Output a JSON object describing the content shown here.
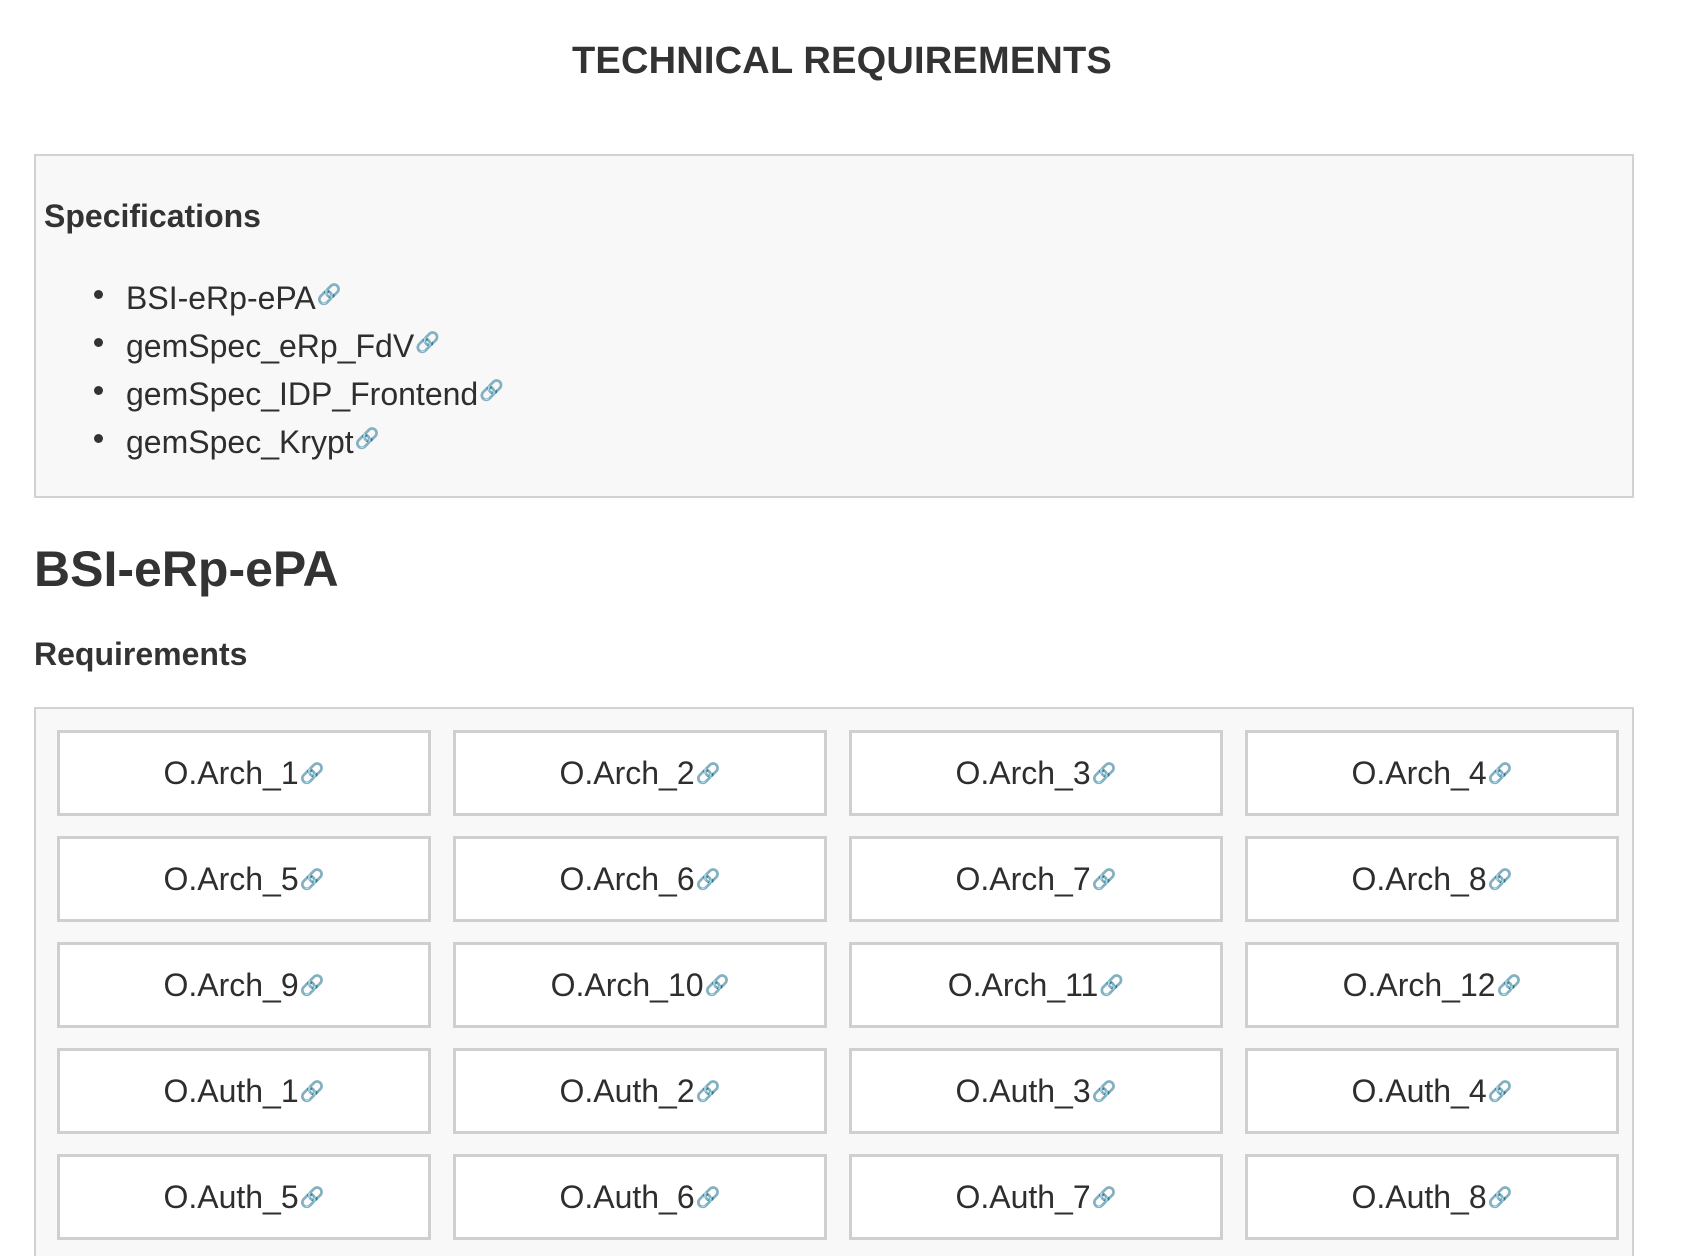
{
  "page": {
    "title": "TECHNICAL REQUIREMENTS"
  },
  "specifications": {
    "heading": "Specifications",
    "link_icon": "🔗",
    "items": [
      {
        "label": "BSI-eRp-ePA"
      },
      {
        "label": "gemSpec_eRp_FdV"
      },
      {
        "label": "gemSpec_IDP_Frontend"
      },
      {
        "label": "gemSpec_Krypt"
      }
    ]
  },
  "section": {
    "title": "BSI-eRp-ePA",
    "requirements_heading": "Requirements",
    "requirements": [
      {
        "label": "O.Arch_1"
      },
      {
        "label": "O.Arch_2"
      },
      {
        "label": "O.Arch_3"
      },
      {
        "label": "O.Arch_4"
      },
      {
        "label": "O.Arch_5"
      },
      {
        "label": "O.Arch_6"
      },
      {
        "label": "O.Arch_7"
      },
      {
        "label": "O.Arch_8"
      },
      {
        "label": "O.Arch_9"
      },
      {
        "label": "O.Arch_10"
      },
      {
        "label": "O.Arch_11"
      },
      {
        "label": "O.Arch_12"
      },
      {
        "label": "O.Auth_1"
      },
      {
        "label": "O.Auth_2"
      },
      {
        "label": "O.Auth_3"
      },
      {
        "label": "O.Auth_4"
      },
      {
        "label": "O.Auth_5"
      },
      {
        "label": "O.Auth_6"
      },
      {
        "label": "O.Auth_7"
      },
      {
        "label": "O.Auth_8"
      }
    ]
  },
  "colors": {
    "text": "#2e2e2e",
    "panel_background": "#f8f8f8",
    "panel_border": "#d2d2d2",
    "cell_border": "#cfcfcf"
  }
}
